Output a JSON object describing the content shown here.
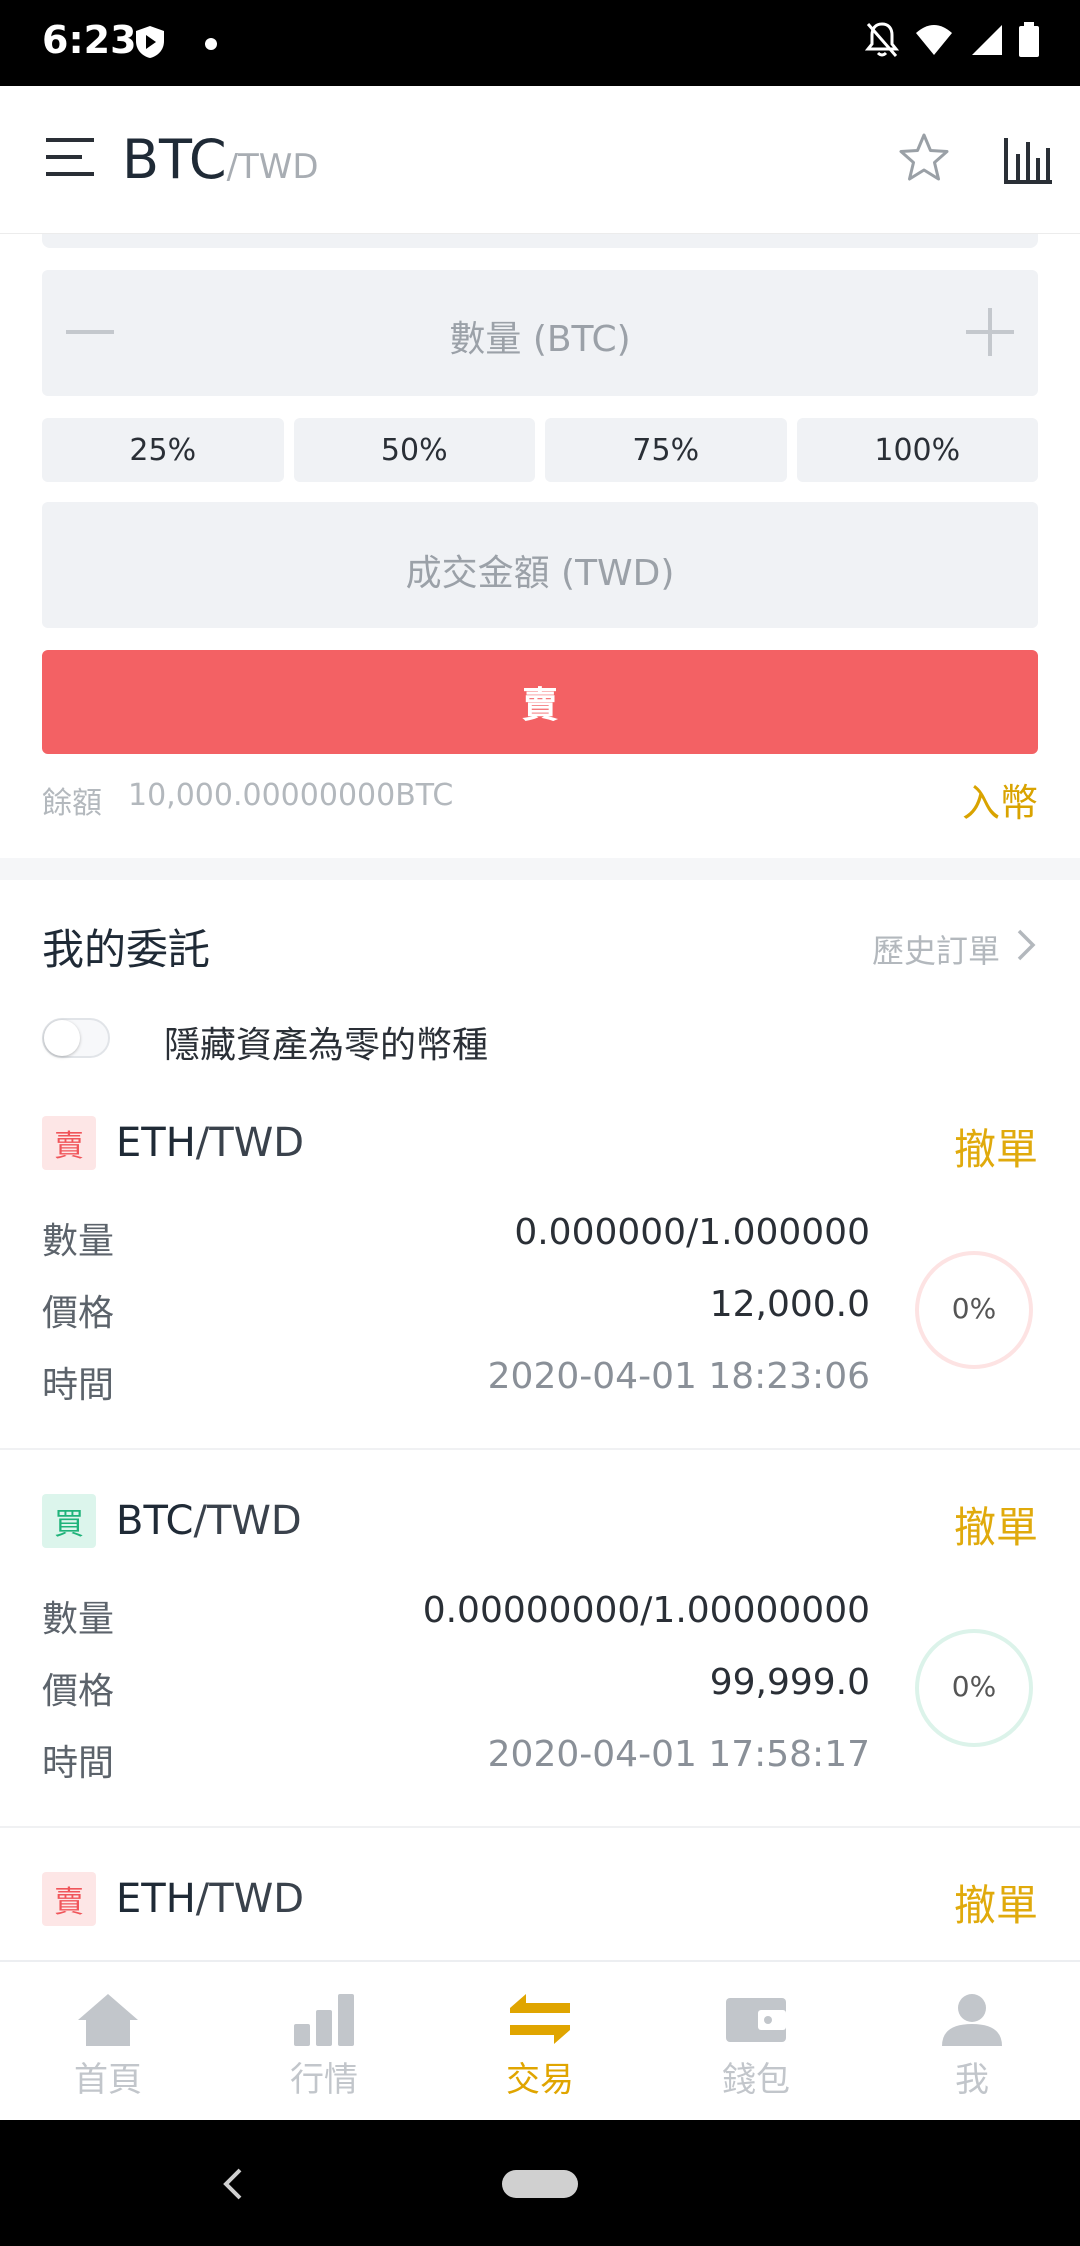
{
  "status_bar": {
    "time": "6:23",
    "icons": [
      "shield-icon",
      "notification-dot",
      "bell-off-icon",
      "wifi-icon",
      "signal-icon",
      "battery-icon"
    ]
  },
  "header": {
    "base": "BTC",
    "quote": "/TWD",
    "icons": [
      "menu-icon",
      "star-icon",
      "chart-icon"
    ]
  },
  "form": {
    "quantity_placeholder": "數量 (BTC)",
    "percentages": [
      "25%",
      "50%",
      "75%",
      "100%"
    ],
    "amount_placeholder": "成交金額 (TWD)",
    "sell_label": "賣",
    "balance_label": "餘額",
    "balance_value": "10,000.00000000BTC",
    "deposit_label": "入幣"
  },
  "orders": {
    "title": "我的委託",
    "history_label": "歷史訂單",
    "hide_zero_label": "隱藏資產為零的幣種",
    "hide_zero_enabled": false,
    "labels": {
      "quantity": "數量",
      "price": "價格",
      "time": "時間"
    },
    "cancel_label": "撤單",
    "items": [
      {
        "side": "賣",
        "base": "ETH",
        "quote": "/TWD",
        "quantity": "0.000000/1.000000",
        "price": "12,000.0",
        "time": "2020-04-01 18:23:06",
        "progress": "0%"
      },
      {
        "side": "買",
        "base": "BTC",
        "quote": "/TWD",
        "quantity": "0.00000000/1.00000000",
        "price": "99,999.0",
        "time": "2020-04-01 17:58:17",
        "progress": "0%"
      },
      {
        "side": "賣",
        "base": "ETH",
        "quote": "/TWD"
      }
    ]
  },
  "bottom_nav": {
    "items": [
      {
        "label": "首頁",
        "icon": "home-icon"
      },
      {
        "label": "行情",
        "icon": "market-icon"
      },
      {
        "label": "交易",
        "icon": "trade-icon",
        "active": true
      },
      {
        "label": "錢包",
        "icon": "wallet-icon"
      },
      {
        "label": "我",
        "icon": "profile-icon"
      }
    ]
  },
  "colors": {
    "sell": "#f36164",
    "buy": "#1fb37a",
    "accent": "#e0a500"
  }
}
